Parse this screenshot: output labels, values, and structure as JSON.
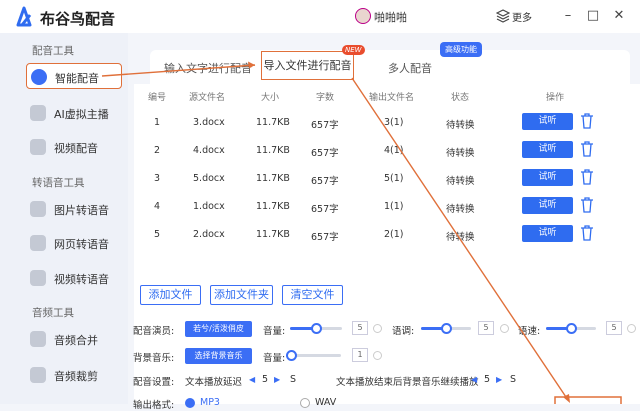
{
  "app": {
    "title": "布谷鸟配音",
    "user_name": "啪啪啪",
    "more_label": "更多",
    "minimize": "–",
    "maximize": "□",
    "close": "✕"
  },
  "sidebar": {
    "sections": [
      "配音工具",
      "转语音工具",
      "音频工具"
    ],
    "items": [
      {
        "label": "智能配音",
        "icon": "voice-icon"
      },
      {
        "label": "AI虚拟主播",
        "icon": "avatar-icon"
      },
      {
        "label": "视频配音",
        "icon": "video-icon"
      },
      {
        "label": "图片转语音",
        "icon": "image-icon"
      },
      {
        "label": "网页转语音",
        "icon": "web-icon"
      },
      {
        "label": "视频转语音",
        "icon": "video-audio-icon"
      },
      {
        "label": "音频合并",
        "icon": "merge-icon"
      },
      {
        "label": "音频裁剪",
        "icon": "cut-icon"
      }
    ]
  },
  "tabs": [
    {
      "label": "输入文字进行配音"
    },
    {
      "label": "导入文件进行配音"
    },
    {
      "label": "多人配音"
    }
  ],
  "badges": {
    "new": "NEW",
    "premium": "高级功能"
  },
  "table": {
    "headers": [
      "编号",
      "源文件名",
      "大小",
      "字数",
      "输出文件名",
      "状态",
      "操作"
    ],
    "listen_label": "试听",
    "rows": [
      {
        "num": "1",
        "source": "3.docx",
        "size": "11.7KB",
        "words": "657字",
        "output": "3(1)",
        "status": "待转换"
      },
      {
        "num": "2",
        "source": "4.docx",
        "size": "11.7KB",
        "words": "657字",
        "output": "4(1)",
        "status": "待转换"
      },
      {
        "num": "3",
        "source": "5.docx",
        "size": "11.7KB",
        "words": "657字",
        "output": "5(1)",
        "status": "待转换"
      },
      {
        "num": "4",
        "source": "1.docx",
        "size": "11.7KB",
        "words": "657字",
        "output": "1(1)",
        "status": "待转换"
      },
      {
        "num": "5",
        "source": "2.docx",
        "size": "11.7KB",
        "words": "657字",
        "output": "2(1)",
        "status": "待转换"
      }
    ]
  },
  "actions": {
    "add_file": "添加文件",
    "add_folder": "添加文件夹",
    "clear": "清空文件"
  },
  "settings": {
    "voice_label": "配音演员:",
    "voice_value": "若兮/活泼俏皮",
    "volume_label": "音量:",
    "volume_value": "5",
    "volume_level": 0.5,
    "tone_label": "语调:",
    "tone_value": "5",
    "tone_level": 0.5,
    "speed_label": "语速:",
    "speed_value": "5",
    "speed_level": 0.5,
    "bgm_label": "背景音乐:",
    "bgm_value": "选择背景音乐",
    "bgm_volume_label": "音量:",
    "bgm_volume_value": "1",
    "bgm_volume_level": 0.0,
    "config_label": "配音设置:",
    "delay_label": "文本播放延迟",
    "delay_value": "5",
    "delay_unit": "S",
    "bgm_after_label": "文本播放结束后背景音乐继续播放",
    "bgm_after_value": "5",
    "bgm_after_unit": "S",
    "format_label": "输出格式:",
    "format_mp3": "MP3",
    "format_wav": "WAV"
  },
  "colors": {
    "accent": "#3b6ef5",
    "highlight": "#e0703a"
  }
}
